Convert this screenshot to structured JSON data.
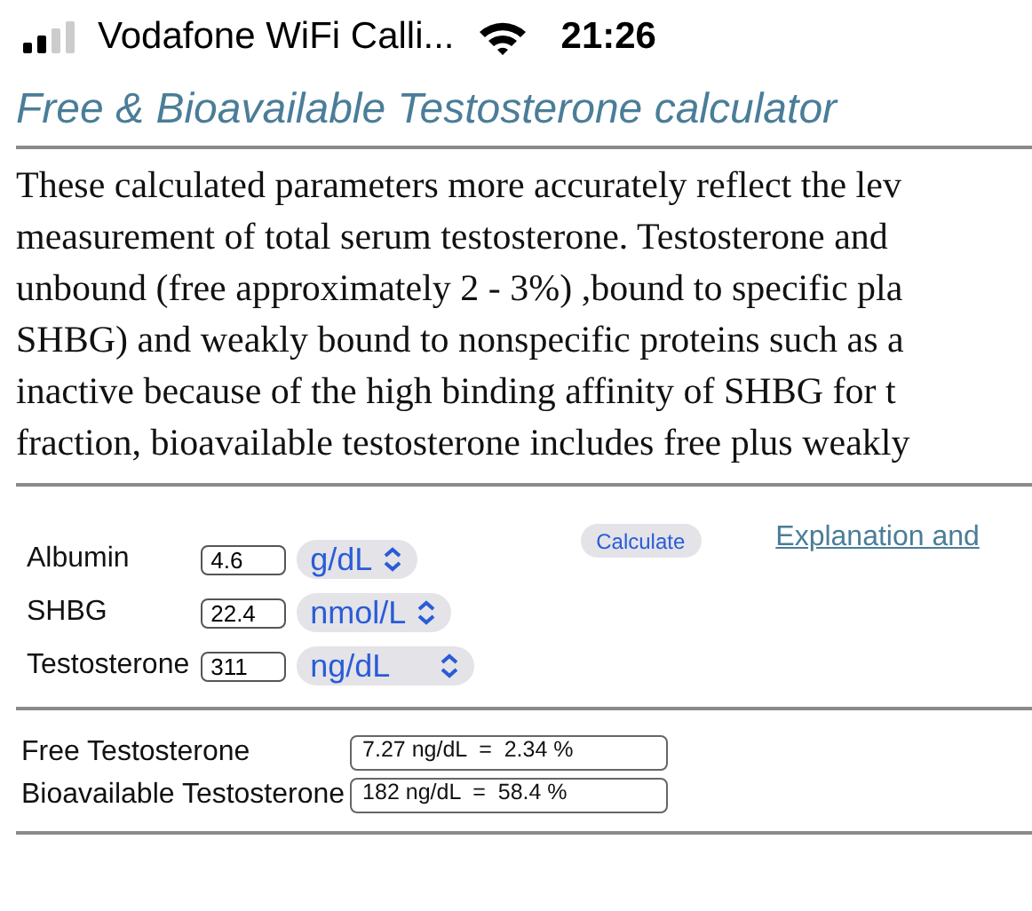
{
  "status_bar": {
    "carrier": "Vodafone WiFi Calli...",
    "time": "21:26"
  },
  "title": "Free & Bioavailable Testosterone calculator",
  "intro_lines": [
    "These calculated parameters more accurately reflect the lev",
    "measurement of total serum testosterone. Testosterone and",
    "unbound (free approximately 2 - 3%) ,bound to specific pla",
    "SHBG) and weakly bound to nonspecific proteins such as a",
    "inactive because of the high binding affinity of SHBG for t",
    "fraction, bioavailable testosterone includes free plus weakly"
  ],
  "inputs": [
    {
      "label": "Albumin",
      "value": "4.6",
      "unit": "g/dL"
    },
    {
      "label": "SHBG",
      "value": "22.4",
      "unit": "nmol/L"
    },
    {
      "label": "Testosterone",
      "value": "311",
      "unit": "ng/dL"
    }
  ],
  "calculate_button": "Calculate",
  "explanation_link": "Explanation and",
  "results": [
    {
      "label": "Free Testosterone",
      "value": "7.27 ng/dL  =  2.34 %"
    },
    {
      "label": "Bioavailable Testosterone",
      "value": "182 ng/dL  =  58.4 %"
    }
  ]
}
